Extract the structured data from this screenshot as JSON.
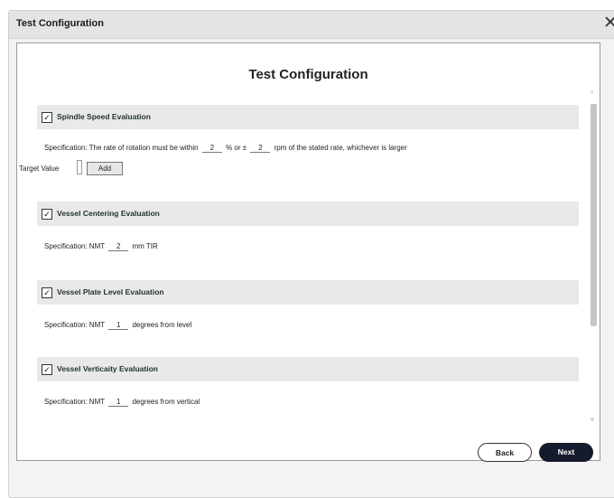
{
  "window": {
    "title": "Test Configuration",
    "close_glyph": "✕"
  },
  "panel": {
    "title": "Test Configuration"
  },
  "sections": [
    {
      "label": "Spindle Speed Evaluation",
      "checked": true,
      "spec_prefix": "Specification: The rate of rotation must be within",
      "value1": "2",
      "mid": "% or ±",
      "value2": "2",
      "spec_suffix": "rpm of the stated rate, whichever is larger"
    },
    {
      "label": "Vessel Centering Evaluation",
      "checked": true,
      "spec_prefix": "Specification: NMT",
      "value1": "2",
      "spec_suffix": "mm TIR"
    },
    {
      "label": "Vessel Plate Level Evaluation",
      "checked": true,
      "spec_prefix": "Specification: NMT",
      "value1": "1",
      "spec_suffix": "degrees from level"
    },
    {
      "label": "Vessel Verticaity Evaluation",
      "checked": true,
      "spec_prefix": "Specification: NMT",
      "value1": "1",
      "spec_suffix": "degrees from vertical"
    }
  ],
  "target": {
    "label": "Target Value",
    "add_label": "Add"
  },
  "checkmark": "✓",
  "scroll": {
    "up": "^",
    "down": "v"
  },
  "buttons": {
    "back": "Back",
    "next": "Next"
  }
}
